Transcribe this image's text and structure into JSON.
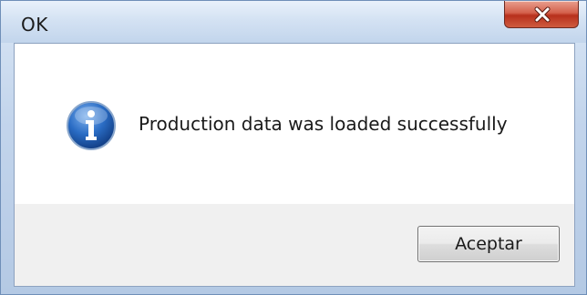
{
  "window": {
    "title": "OK",
    "close_icon": "close-icon"
  },
  "dialog": {
    "icon": "info-icon",
    "message": "Production data was loaded successfully",
    "button_label": "Aceptar"
  },
  "colors": {
    "close_button": "#c74a34",
    "info_icon": "#1f5fb5"
  }
}
